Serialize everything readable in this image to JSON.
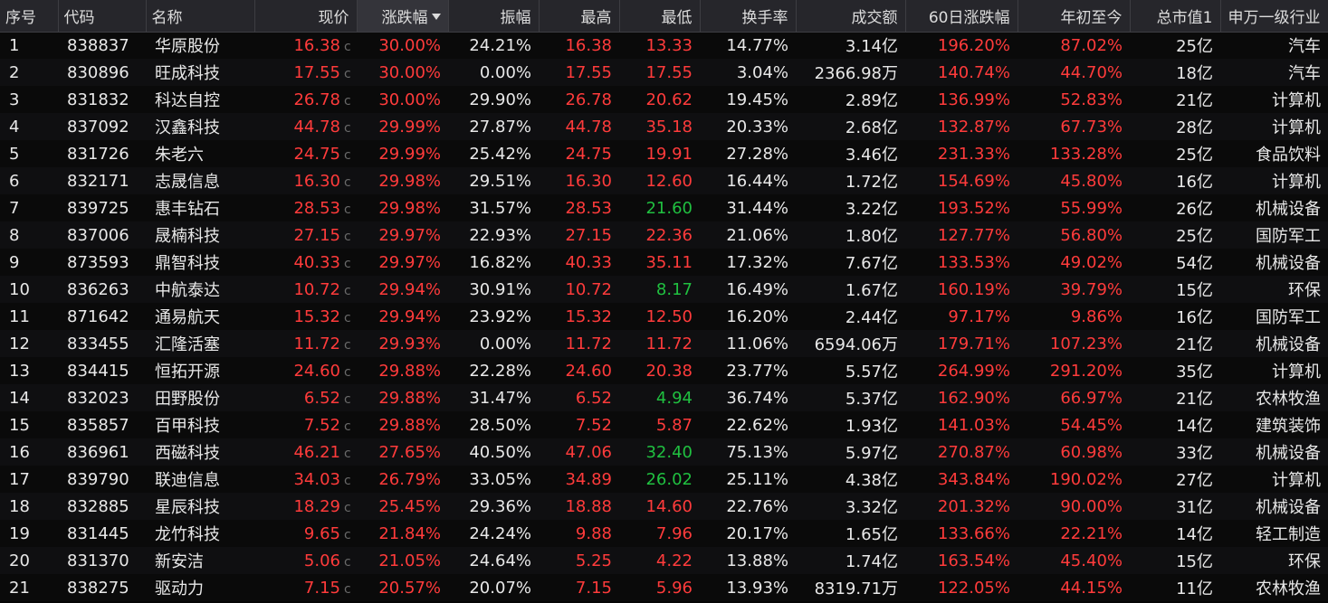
{
  "colors": {
    "up": "#ff3b3b",
    "down": "#20c040",
    "flat": "#e8e8e8",
    "header_bg": "#26262b",
    "row_bg": "#0a0a0a"
  },
  "headers": {
    "seq": "序号",
    "code": "代码",
    "name": "名称",
    "price": "现价",
    "change": "涨跌幅",
    "amplitude": "振幅",
    "high": "最高",
    "low": "最低",
    "turnover": "换手率",
    "volume": "成交额",
    "d60": "60日涨跌幅",
    "ytd": "年初至今",
    "mcap": "总市值1",
    "industry": "申万一级行业"
  },
  "sort": {
    "column": "change",
    "direction": "desc",
    "icon": "sort-desc-icon"
  },
  "price_marker": "c",
  "rows": [
    {
      "seq": "1",
      "code": "838837",
      "name": "华原股份",
      "price": "16.38",
      "change": "30.00%",
      "amplitude": "24.21%",
      "high": "16.38",
      "high_c": "up",
      "low": "13.33",
      "low_c": "up",
      "turnover": "14.77%",
      "volume": "3.14亿",
      "d60": "196.20%",
      "ytd": "87.02%",
      "mcap": "25亿",
      "industry": "汽车"
    },
    {
      "seq": "2",
      "code": "830896",
      "name": "旺成科技",
      "price": "17.55",
      "change": "30.00%",
      "amplitude": "0.00%",
      "high": "17.55",
      "high_c": "up",
      "low": "17.55",
      "low_c": "up",
      "turnover": "3.04%",
      "volume": "2366.98万",
      "d60": "140.74%",
      "ytd": "44.70%",
      "mcap": "18亿",
      "industry": "汽车"
    },
    {
      "seq": "3",
      "code": "831832",
      "name": "科达自控",
      "price": "26.78",
      "change": "30.00%",
      "amplitude": "29.90%",
      "high": "26.78",
      "high_c": "up",
      "low": "20.62",
      "low_c": "up",
      "turnover": "19.45%",
      "volume": "2.89亿",
      "d60": "136.99%",
      "ytd": "52.83%",
      "mcap": "21亿",
      "industry": "计算机"
    },
    {
      "seq": "4",
      "code": "837092",
      "name": "汉鑫科技",
      "price": "44.78",
      "change": "29.99%",
      "amplitude": "27.87%",
      "high": "44.78",
      "high_c": "up",
      "low": "35.18",
      "low_c": "up",
      "turnover": "20.33%",
      "volume": "2.68亿",
      "d60": "132.87%",
      "ytd": "67.73%",
      "mcap": "28亿",
      "industry": "计算机"
    },
    {
      "seq": "5",
      "code": "831726",
      "name": "朱老六",
      "price": "24.75",
      "change": "29.99%",
      "amplitude": "25.42%",
      "high": "24.75",
      "high_c": "up",
      "low": "19.91",
      "low_c": "up",
      "turnover": "27.28%",
      "volume": "3.46亿",
      "d60": "231.33%",
      "ytd": "133.28%",
      "mcap": "25亿",
      "industry": "食品饮料"
    },
    {
      "seq": "6",
      "code": "832171",
      "name": "志晟信息",
      "price": "16.30",
      "change": "29.98%",
      "amplitude": "29.51%",
      "high": "16.30",
      "high_c": "up",
      "low": "12.60",
      "low_c": "up",
      "turnover": "16.44%",
      "volume": "1.72亿",
      "d60": "154.69%",
      "ytd": "45.80%",
      "mcap": "16亿",
      "industry": "计算机"
    },
    {
      "seq": "7",
      "code": "839725",
      "name": "惠丰钻石",
      "price": "28.53",
      "change": "29.98%",
      "amplitude": "31.57%",
      "high": "28.53",
      "high_c": "up",
      "low": "21.60",
      "low_c": "down",
      "turnover": "31.44%",
      "volume": "3.22亿",
      "d60": "193.52%",
      "ytd": "55.99%",
      "mcap": "26亿",
      "industry": "机械设备"
    },
    {
      "seq": "8",
      "code": "837006",
      "name": "晟楠科技",
      "price": "27.15",
      "change": "29.97%",
      "amplitude": "22.93%",
      "high": "27.15",
      "high_c": "up",
      "low": "22.36",
      "low_c": "up",
      "turnover": "21.06%",
      "volume": "1.80亿",
      "d60": "127.77%",
      "ytd": "56.80%",
      "mcap": "25亿",
      "industry": "国防军工"
    },
    {
      "seq": "9",
      "code": "873593",
      "name": "鼎智科技",
      "price": "40.33",
      "change": "29.97%",
      "amplitude": "16.82%",
      "high": "40.33",
      "high_c": "up",
      "low": "35.11",
      "low_c": "up",
      "turnover": "17.32%",
      "volume": "7.67亿",
      "d60": "133.53%",
      "ytd": "49.02%",
      "mcap": "54亿",
      "industry": "机械设备"
    },
    {
      "seq": "10",
      "code": "836263",
      "name": "中航泰达",
      "price": "10.72",
      "change": "29.94%",
      "amplitude": "30.91%",
      "high": "10.72",
      "high_c": "up",
      "low": "8.17",
      "low_c": "down",
      "turnover": "16.49%",
      "volume": "1.67亿",
      "d60": "160.19%",
      "ytd": "39.79%",
      "mcap": "15亿",
      "industry": "环保"
    },
    {
      "seq": "11",
      "code": "871642",
      "name": "通易航天",
      "price": "15.32",
      "change": "29.94%",
      "amplitude": "23.92%",
      "high": "15.32",
      "high_c": "up",
      "low": "12.50",
      "low_c": "up",
      "turnover": "16.20%",
      "volume": "2.44亿",
      "d60": "97.17%",
      "ytd": "9.86%",
      "mcap": "16亿",
      "industry": "国防军工"
    },
    {
      "seq": "12",
      "code": "833455",
      "name": "汇隆活塞",
      "price": "11.72",
      "change": "29.93%",
      "amplitude": "0.00%",
      "high": "11.72",
      "high_c": "up",
      "low": "11.72",
      "low_c": "up",
      "turnover": "11.06%",
      "volume": "6594.06万",
      "d60": "179.71%",
      "ytd": "107.23%",
      "mcap": "21亿",
      "industry": "机械设备"
    },
    {
      "seq": "13",
      "code": "834415",
      "name": "恒拓开源",
      "price": "24.60",
      "change": "29.88%",
      "amplitude": "22.28%",
      "high": "24.60",
      "high_c": "up",
      "low": "20.38",
      "low_c": "up",
      "turnover": "23.77%",
      "volume": "5.57亿",
      "d60": "264.99%",
      "ytd": "291.20%",
      "mcap": "35亿",
      "industry": "计算机"
    },
    {
      "seq": "14",
      "code": "832023",
      "name": "田野股份",
      "price": "6.52",
      "change": "29.88%",
      "amplitude": "31.47%",
      "high": "6.52",
      "high_c": "up",
      "low": "4.94",
      "low_c": "down",
      "turnover": "36.74%",
      "volume": "5.37亿",
      "d60": "162.90%",
      "ytd": "66.97%",
      "mcap": "21亿",
      "industry": "农林牧渔"
    },
    {
      "seq": "15",
      "code": "835857",
      "name": "百甲科技",
      "price": "7.52",
      "change": "29.88%",
      "amplitude": "28.50%",
      "high": "7.52",
      "high_c": "up",
      "low": "5.87",
      "low_c": "up",
      "turnover": "22.62%",
      "volume": "1.93亿",
      "d60": "141.03%",
      "ytd": "54.45%",
      "mcap": "14亿",
      "industry": "建筑装饰"
    },
    {
      "seq": "16",
      "code": "836961",
      "name": "西磁科技",
      "price": "46.21",
      "change": "27.65%",
      "amplitude": "40.50%",
      "high": "47.06",
      "high_c": "up",
      "low": "32.40",
      "low_c": "down",
      "turnover": "75.13%",
      "volume": "5.97亿",
      "d60": "270.87%",
      "ytd": "60.98%",
      "mcap": "33亿",
      "industry": "机械设备"
    },
    {
      "seq": "17",
      "code": "839790",
      "name": "联迪信息",
      "price": "34.03",
      "change": "26.79%",
      "amplitude": "33.05%",
      "high": "34.89",
      "high_c": "up",
      "low": "26.02",
      "low_c": "down",
      "turnover": "25.11%",
      "volume": "4.38亿",
      "d60": "343.84%",
      "ytd": "190.02%",
      "mcap": "27亿",
      "industry": "计算机"
    },
    {
      "seq": "18",
      "code": "832885",
      "name": "星辰科技",
      "price": "18.29",
      "change": "25.45%",
      "amplitude": "29.36%",
      "high": "18.88",
      "high_c": "up",
      "low": "14.60",
      "low_c": "up",
      "turnover": "22.76%",
      "volume": "3.32亿",
      "d60": "201.32%",
      "ytd": "90.00%",
      "mcap": "31亿",
      "industry": "机械设备"
    },
    {
      "seq": "19",
      "code": "831445",
      "name": "龙竹科技",
      "price": "9.65",
      "change": "21.84%",
      "amplitude": "24.24%",
      "high": "9.88",
      "high_c": "up",
      "low": "7.96",
      "low_c": "up",
      "turnover": "20.17%",
      "volume": "1.65亿",
      "d60": "133.66%",
      "ytd": "22.21%",
      "mcap": "14亿",
      "industry": "轻工制造"
    },
    {
      "seq": "20",
      "code": "831370",
      "name": "新安洁",
      "price": "5.06",
      "change": "21.05%",
      "amplitude": "24.64%",
      "high": "5.25",
      "high_c": "up",
      "low": "4.22",
      "low_c": "up",
      "turnover": "13.88%",
      "volume": "1.74亿",
      "d60": "163.54%",
      "ytd": "45.40%",
      "mcap": "15亿",
      "industry": "环保"
    },
    {
      "seq": "21",
      "code": "838275",
      "name": "驱动力",
      "price": "7.15",
      "change": "20.57%",
      "amplitude": "20.07%",
      "high": "7.15",
      "high_c": "up",
      "low": "5.96",
      "low_c": "up",
      "turnover": "13.93%",
      "volume": "8319.71万",
      "d60": "122.05%",
      "ytd": "44.15%",
      "mcap": "11亿",
      "industry": "农林牧渔"
    }
  ]
}
